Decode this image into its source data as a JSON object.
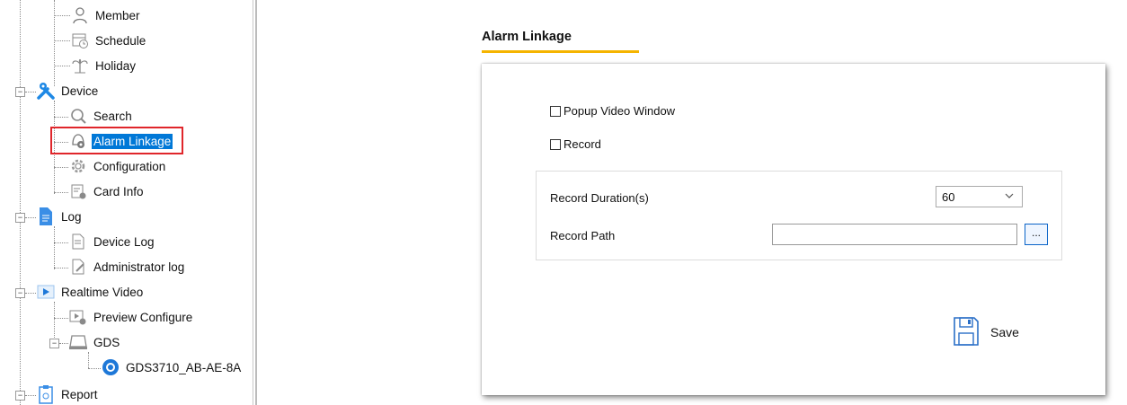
{
  "tree": {
    "items": [
      {
        "label": "Member"
      },
      {
        "label": "Schedule"
      },
      {
        "label": "Holiday"
      },
      {
        "label": "Device"
      },
      {
        "label": "Search"
      },
      {
        "label": "Alarm Linkage"
      },
      {
        "label": "Configuration"
      },
      {
        "label": "Card Info"
      },
      {
        "label": "Log"
      },
      {
        "label": "Device Log"
      },
      {
        "label": "Administrator log"
      },
      {
        "label": "Realtime Video"
      },
      {
        "label": "Preview Configure"
      },
      {
        "label": "GDS"
      },
      {
        "label": "GDS3710_AB-AE-8A"
      },
      {
        "label": "Report"
      }
    ],
    "expanders": {
      "device": "−",
      "log": "−",
      "realtime_video": "−",
      "gds": "−",
      "report": "−"
    }
  },
  "page": {
    "title": "Alarm Linkage"
  },
  "form": {
    "popup_video_label": "Popup Video Window",
    "record_label": "Record",
    "record_duration_label": "Record Duration(s)",
    "record_duration_value": "60",
    "record_path_label": "Record Path",
    "record_path_value": "",
    "browse_label": "...",
    "save_label": "Save"
  },
  "colors": {
    "selection": "#0078d7",
    "highlight": "#e0262b",
    "title_underline": "#f5b400"
  }
}
